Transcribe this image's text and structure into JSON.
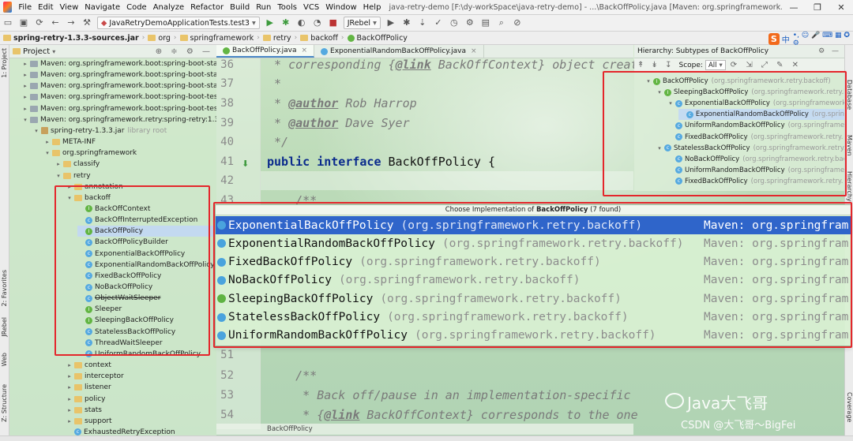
{
  "menu": {
    "items": [
      "File",
      "Edit",
      "View",
      "Navigate",
      "Code",
      "Analyze",
      "Refactor",
      "Build",
      "Run",
      "Tools",
      "VCS",
      "Window",
      "Help"
    ],
    "title": "java-retry-demo [F:\\dy-workSpace\\java-retry-demo] - ...\\BackOffPolicy.java [Maven: org.springframework.retry:spring-retry:1.3.3]",
    "window_controls": [
      "—",
      "❐",
      "✕"
    ]
  },
  "toolbar": {
    "run_config": "JavaRetryDemoApplicationTests.test3",
    "jrebel": "JRebel"
  },
  "breadcrumb": [
    "spring-retry-1.3.3-sources.jar",
    "org",
    "springframework",
    "retry",
    "backoff",
    "BackOffPolicy"
  ],
  "ime": {
    "label": "中",
    "extras": "•, ☺ 🎤 ⌨ ▦ ✪ ⚙"
  },
  "left_stripe": {
    "project": "1: Project",
    "favorites": "2: Favorites",
    "rebel": "JRebel",
    "web": "Web",
    "structure": "Z: Structure"
  },
  "project": {
    "header": "Project",
    "rows": [
      {
        "text": "Maven: org.springframework.boot:spring-boot-starte",
        "indent": 0,
        "icon": "lib",
        "arrow": "▸"
      },
      {
        "text": "Maven: org.springframework.boot:spring-boot-starte",
        "indent": 0,
        "icon": "lib",
        "arrow": "▸"
      },
      {
        "text": "Maven: org.springframework.boot:spring-boot-starte",
        "indent": 0,
        "icon": "lib",
        "arrow": "▸"
      },
      {
        "text": "Maven: org.springframework.boot:spring-boot-test:2",
        "indent": 0,
        "icon": "lib",
        "arrow": "▸"
      },
      {
        "text": "Maven: org.springframework.boot:spring-boot-test-a",
        "indent": 0,
        "icon": "lib",
        "arrow": "▸"
      },
      {
        "text": "Maven: org.springframework.retry:spring-retry:1.3.3",
        "indent": 0,
        "icon": "lib",
        "arrow": "▾"
      },
      {
        "text": "spring-retry-1.3.3.jar",
        "suffix": "library root",
        "indent": 1,
        "icon": "jar",
        "arrow": "▾"
      },
      {
        "text": "META-INF",
        "indent": 2,
        "icon": "folder",
        "arrow": "▸"
      },
      {
        "text": "org.springframework",
        "indent": 2,
        "icon": "folder",
        "arrow": "▾"
      },
      {
        "text": "classify",
        "indent": 3,
        "icon": "folder",
        "arrow": "▸"
      },
      {
        "text": "retry",
        "indent": 3,
        "icon": "folder",
        "arrow": "▾"
      },
      {
        "text": "annotation",
        "indent": 4,
        "icon": "folder",
        "arrow": "▸"
      },
      {
        "text": "backoff",
        "indent": 4,
        "icon": "folder",
        "arrow": "▾"
      },
      {
        "text": "BackOffContext",
        "indent": 5,
        "icon": "i"
      },
      {
        "text": "BackOffInterruptedException",
        "indent": 5,
        "icon": "c"
      },
      {
        "text": "BackOffPolicy",
        "indent": 5,
        "icon": "i",
        "selected": true
      },
      {
        "text": "BackOffPolicyBuilder",
        "indent": 5,
        "icon": "c"
      },
      {
        "text": "ExponentialBackOffPolicy",
        "indent": 5,
        "icon": "c"
      },
      {
        "text": "ExponentialRandomBackOffPolicy",
        "indent": 5,
        "icon": "c"
      },
      {
        "text": "FixedBackOffPolicy",
        "indent": 5,
        "icon": "c"
      },
      {
        "text": "NoBackOffPolicy",
        "indent": 5,
        "icon": "c"
      },
      {
        "text": "ObjectWaitSleeper",
        "indent": 5,
        "icon": "c",
        "strike": true
      },
      {
        "text": "Sleeper",
        "indent": 5,
        "icon": "i"
      },
      {
        "text": "SleepingBackOffPolicy",
        "indent": 5,
        "icon": "i"
      },
      {
        "text": "StatelessBackOffPolicy",
        "indent": 5,
        "icon": "c"
      },
      {
        "text": "ThreadWaitSleeper",
        "indent": 5,
        "icon": "c"
      },
      {
        "text": "UniformRandomBackOffPolicy",
        "indent": 5,
        "icon": "c"
      },
      {
        "text": "context",
        "indent": 4,
        "icon": "folder",
        "arrow": "▸"
      },
      {
        "text": "interceptor",
        "indent": 4,
        "icon": "folder",
        "arrow": "▸"
      },
      {
        "text": "listener",
        "indent": 4,
        "icon": "folder",
        "arrow": "▸"
      },
      {
        "text": "policy",
        "indent": 4,
        "icon": "folder",
        "arrow": "▸"
      },
      {
        "text": "stats",
        "indent": 4,
        "icon": "folder",
        "arrow": "▸"
      },
      {
        "text": "support",
        "indent": 4,
        "icon": "folder",
        "arrow": "▸"
      },
      {
        "text": "ExhaustedRetryException",
        "indent": 4,
        "icon": "c"
      }
    ]
  },
  "editor": {
    "tabs": [
      {
        "label": "BackOffPolicy.java",
        "active": true
      },
      {
        "label": "ExponentialRandomBackOffPolicy.java",
        "active": false
      }
    ],
    "lines": [
      {
        "num": "36",
        "parts": [
          {
            "t": " * corresponding {",
            "c": "cmt"
          },
          {
            "t": "@link",
            "c": "tag"
          },
          {
            "t": " BackOffContext",
            "c": "cmt"
          },
          {
            "t": "} object creat",
            "c": "cmt"
          }
        ]
      },
      {
        "num": "37",
        "parts": [
          {
            "t": " *",
            "c": "cmt"
          }
        ]
      },
      {
        "num": "38",
        "parts": [
          {
            "t": " * ",
            "c": "cmt"
          },
          {
            "t": "@author",
            "c": "tag"
          },
          {
            "t": " Rob Harrop",
            "c": "cmt"
          }
        ]
      },
      {
        "num": "39",
        "parts": [
          {
            "t": " * ",
            "c": "cmt"
          },
          {
            "t": "@author",
            "c": "tag"
          },
          {
            "t": " Dave Syer",
            "c": "cmt"
          }
        ]
      },
      {
        "num": "40",
        "parts": [
          {
            "t": " */",
            "c": "cmt"
          }
        ]
      },
      {
        "num": "41",
        "parts": [
          {
            "t": "public interface ",
            "c": "kw"
          },
          {
            "t": "BackOffPolicy {",
            "c": "ident"
          }
        ]
      },
      {
        "num": "42",
        "parts": [
          {
            "t": "",
            "c": "ident"
          }
        ]
      },
      {
        "num": "43",
        "parts": [
          {
            "t": "    /**",
            "c": "cmt"
          }
        ]
      },
      {
        "num": "51",
        "parts": [
          {
            "t": "",
            "c": "ident"
          }
        ]
      },
      {
        "num": "52",
        "parts": [
          {
            "t": "    /**",
            "c": "cmt"
          }
        ]
      },
      {
        "num": "53",
        "parts": [
          {
            "t": "     * Back off/pause in an implementation-specific",
            "c": "cmt"
          }
        ]
      },
      {
        "num": "54",
        "parts": [
          {
            "t": "     * {",
            "c": "cmt"
          },
          {
            "t": "@link",
            "c": "tag"
          },
          {
            "t": " BackOffContext",
            "c": "cmt"
          },
          {
            "t": "} corresponds to the one",
            "c": "cmt"
          }
        ]
      }
    ],
    "footer_crumb": "BackOffPolicy"
  },
  "popup": {
    "title_prefix": "Choose Implementation of ",
    "title_name": "BackOffPolicy",
    "title_suffix": " (7 found)",
    "items": [
      {
        "name": "ExponentialBackOffPolicy",
        "pkg": "(org.springframework.retry.backoff)",
        "lib": "Maven: org.springfram",
        "icon": "c",
        "selected": true
      },
      {
        "name": "ExponentialRandomBackOffPolicy",
        "pkg": "(org.springframework.retry.backoff)",
        "lib": "Maven: org.springfram",
        "icon": "c"
      },
      {
        "name": "FixedBackOffPolicy",
        "pkg": "(org.springframework.retry.backoff)",
        "lib": "Maven: org.springfram",
        "icon": "c"
      },
      {
        "name": "NoBackOffPolicy",
        "pkg": "(org.springframework.retry.backoff)",
        "lib": "Maven: org.springfram",
        "icon": "c"
      },
      {
        "name": "SleepingBackOffPolicy",
        "pkg": "(org.springframework.retry.backoff)",
        "lib": "Maven: org.springfram",
        "icon": "i"
      },
      {
        "name": "StatelessBackOffPolicy",
        "pkg": "(org.springframework.retry.backoff)",
        "lib": "Maven: org.springfram",
        "icon": "c"
      },
      {
        "name": "UniformRandomBackOffPolicy",
        "pkg": "(org.springframework.retry.backoff)",
        "lib": "Maven: org.springfram",
        "icon": "c"
      }
    ]
  },
  "hierarchy": {
    "header": "Hierarchy:  Subtypes of BackOffPolicy",
    "scope_label": "Scope:",
    "scope_value": "All",
    "rows": [
      {
        "name": "BackOffPolicy",
        "pkg": "(org.springframework.retry.backoff)",
        "indent": 0,
        "icon": "i",
        "arrow": "▾"
      },
      {
        "name": "SleepingBackOffPolicy",
        "pkg": "(org.springframework.retry.backoff",
        "indent": 1,
        "icon": "i",
        "arrow": "▾"
      },
      {
        "name": "ExponentialBackOffPolicy",
        "pkg": "(org.springframework",
        "indent": 2,
        "icon": "c",
        "arrow": "▾"
      },
      {
        "name": "ExponentialRandomBackOffPolicy",
        "pkg": "(org.sprin",
        "indent": 3,
        "icon": "c",
        "selected": true
      },
      {
        "name": "UniformRandomBackOffPolicy",
        "pkg": "(org.springframe",
        "indent": 2,
        "icon": "c"
      },
      {
        "name": "FixedBackOffPolicy",
        "pkg": "(org.springframework.retry.",
        "indent": 2,
        "icon": "c"
      },
      {
        "name": "StatelessBackOffPolicy",
        "pkg": "(org.springframework.retry.",
        "indent": 1,
        "icon": "c",
        "arrow": "▾"
      },
      {
        "name": "NoBackOffPolicy",
        "pkg": "(org.springframework.retry.back",
        "indent": 2,
        "icon": "c"
      },
      {
        "name": "UniformRandomBackOffPolicy",
        "pkg": "(org.springframe",
        "indent": 2,
        "icon": "c"
      },
      {
        "name": "FixedBackOffPolicy",
        "pkg": "(org.springframework.retry.",
        "indent": 2,
        "icon": "c"
      }
    ]
  },
  "right_stripe": {
    "database": "Database",
    "maven": "Maven",
    "hierarchy": "Hierarchy",
    "coverage": "Coverage"
  },
  "watermark": {
    "main": "Java大飞哥",
    "sub": "CSDN @大飞哥～BigFei"
  }
}
